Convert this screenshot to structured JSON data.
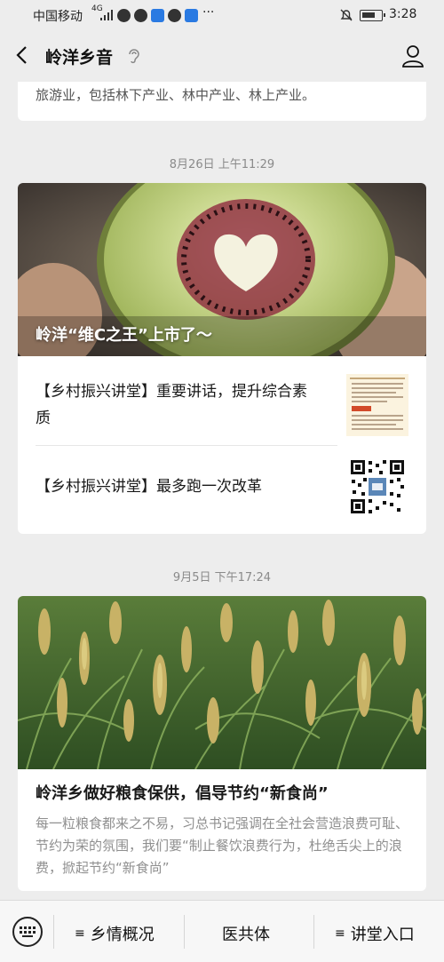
{
  "status_bar": {
    "carrier": "中国移动",
    "network": "4G",
    "more": "···",
    "time": "3:28"
  },
  "nav": {
    "title": "岭洋乡音"
  },
  "top_card": {
    "text": "旅游业，包括林下产业、林中产业、林上产业。"
  },
  "group1": {
    "time": "8月26日 上午11:29",
    "cover_title": "岭洋“维C之王”上市了～",
    "items": [
      {
        "title_line1": "【乡村振兴讲堂】重要讲话，提升综合素",
        "title_line2": "质"
      },
      {
        "title_line1": "【乡村振兴讲堂】最多跑一次改革",
        "title_line2": ""
      }
    ]
  },
  "group2": {
    "time": "9月5日 下午17:24",
    "headline": "岭洋乡做好粮食保供，倡导节约“新食尚”",
    "digest": "每一粒粮食都来之不易，习总书记强调在全社会营造浪费可耻、节约为荣的氛围，我们要“制止餐饮浪费行为，杜绝舌尖上的浪费，掀起节约“新食尚”"
  },
  "bottom_menu": {
    "items": [
      "乡情概况",
      "医共体",
      "讲堂入口"
    ]
  },
  "icons": {
    "back": "chevron-left-icon",
    "ear": "ear-icon",
    "profile": "person-icon",
    "keyboard": "keyboard-icon",
    "menu": "menu-lines-icon"
  }
}
